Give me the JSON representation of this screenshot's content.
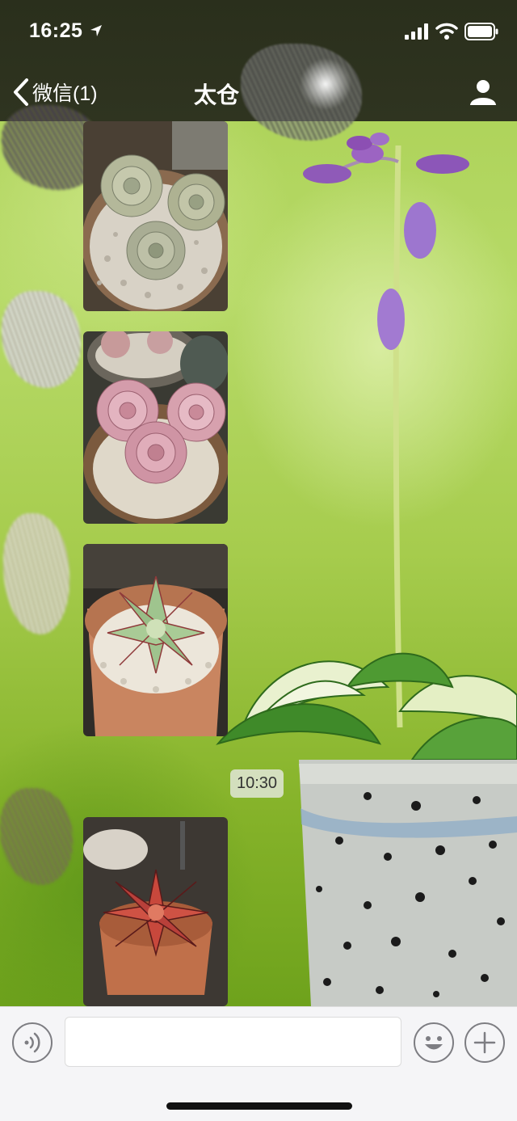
{
  "status_bar": {
    "time": "16:25",
    "icons": [
      "location-arrow-icon",
      "signal-icon",
      "wifi-icon",
      "battery-icon"
    ]
  },
  "nav": {
    "back_label": "微信(1)",
    "title": "太仓",
    "right_icon": "profile-icon"
  },
  "messages": [
    {
      "type": "image",
      "subject": "succulents-grey-rosettes"
    },
    {
      "type": "image",
      "subject": "succulents-pink-rosettes"
    },
    {
      "type": "image",
      "subject": "succulent-green-red-edge"
    },
    {
      "type": "timestamp",
      "text": "10:30"
    },
    {
      "type": "image",
      "subject": "succulent-red"
    }
  ],
  "input_bar": {
    "value": "",
    "icons": [
      "voice-icon",
      "emoji-icon",
      "plus-icon"
    ]
  },
  "colors": {
    "top_band": "#2f3420",
    "wallpaper_green": "#a9cf52",
    "input_bar_bg": "#f5f5f7"
  }
}
